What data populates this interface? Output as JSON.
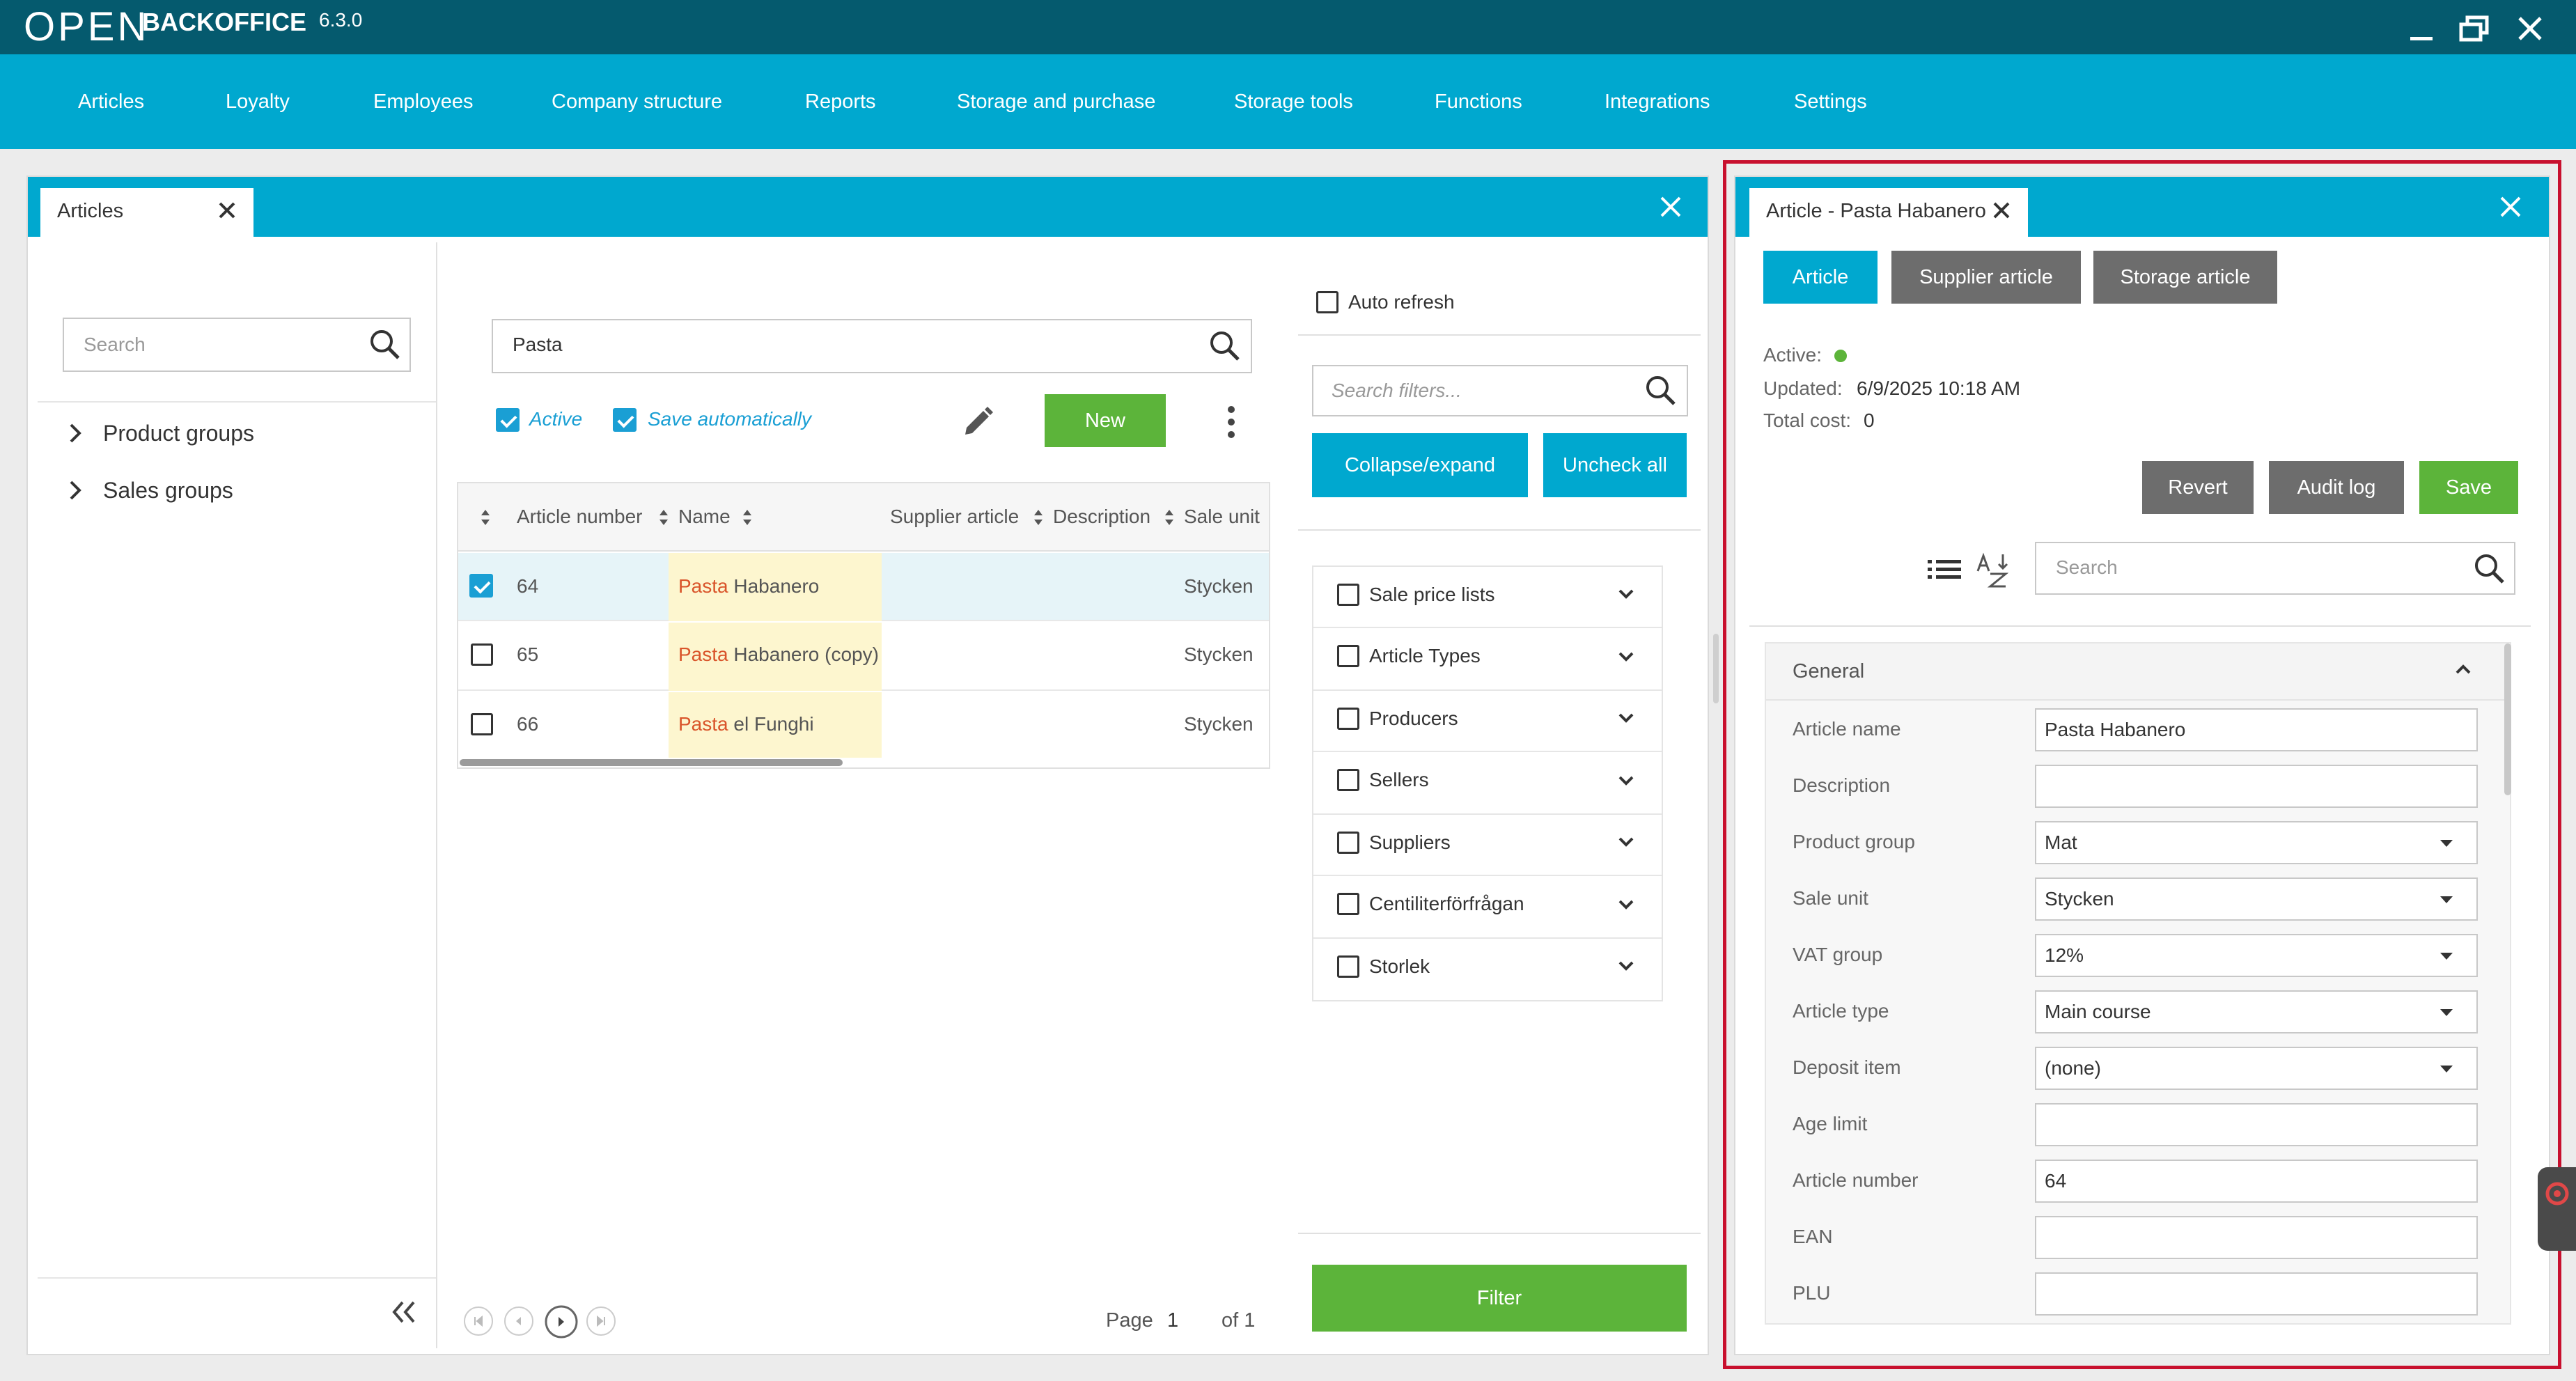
{
  "app": {
    "logo": "OPEN",
    "brand": "BACKOFFICE",
    "version": "6.3.0"
  },
  "menu": [
    "Articles",
    "Loyalty",
    "Employees",
    "Company structure",
    "Reports",
    "Storage and purchase",
    "Storage tools",
    "Functions",
    "Integrations",
    "Settings"
  ],
  "articles_panel": {
    "tab_label": "Articles",
    "tree_search_placeholder": "Search",
    "tree": [
      "Product groups",
      "Sales groups"
    ],
    "search_value": "Pasta",
    "active_label": "Active",
    "save_auto_label": "Save automatically",
    "new_label": "New",
    "columns": [
      "Article number",
      "Name",
      "Supplier article",
      "Description",
      "Sale unit"
    ],
    "rows": [
      {
        "number": "64",
        "name_highlight": "Pasta",
        "name_rest": " Habanero",
        "sale_unit": "Stycken",
        "checked": true
      },
      {
        "number": "65",
        "name_highlight": "Pasta",
        "name_rest": " Habanero (copy)",
        "sale_unit": "Stycken",
        "checked": false
      },
      {
        "number": "66",
        "name_highlight": "Pasta",
        "name_rest": " el Funghi",
        "sale_unit": "Stycken",
        "checked": false
      }
    ],
    "page_label": "Page",
    "page_number": "1",
    "of_label": "of 1"
  },
  "filters": {
    "auto_refresh_label": "Auto refresh",
    "search_placeholder": "Search filters...",
    "collapse_label": "Collapse/expand",
    "uncheck_label": "Uncheck all",
    "items": [
      "Sale price lists",
      "Article Types",
      "Producers",
      "Sellers",
      "Suppliers",
      "Centiliterförfrågan",
      "Storlek"
    ],
    "filter_button": "Filter"
  },
  "article_detail": {
    "tab_label": "Article - Pasta Habanero",
    "tabs": [
      "Article",
      "Supplier article",
      "Storage article"
    ],
    "active_label": "Active:",
    "active_color": "#5cb43a",
    "updated_label": "Updated:",
    "updated_value": "6/9/2025 10:18 AM",
    "total_cost_label": "Total cost:",
    "total_cost_value": "0",
    "revert_label": "Revert",
    "audit_label": "Audit log",
    "save_label": "Save",
    "search_placeholder": "Search",
    "section_title": "General",
    "fields": [
      {
        "label": "Article name",
        "value": "Pasta Habanero",
        "dropdown": false
      },
      {
        "label": "Description",
        "value": "",
        "dropdown": false
      },
      {
        "label": "Product group",
        "value": "Mat",
        "dropdown": true
      },
      {
        "label": "Sale unit",
        "value": "Stycken",
        "dropdown": true
      },
      {
        "label": "VAT group",
        "value": "12%",
        "dropdown": true
      },
      {
        "label": "Article type",
        "value": "Main course",
        "dropdown": true
      },
      {
        "label": "Deposit item",
        "value": "(none)",
        "dropdown": true
      },
      {
        "label": "Age limit",
        "value": "",
        "dropdown": false
      },
      {
        "label": "Article number",
        "value": "64",
        "dropdown": false
      },
      {
        "label": "EAN",
        "value": "",
        "dropdown": false
      },
      {
        "label": "PLU",
        "value": "",
        "dropdown": false
      }
    ]
  },
  "colors": {
    "titlebar": "#055a6e",
    "accent": "#00a8cf",
    "green": "#5cb43a",
    "highlight": "#d9542a",
    "outline": "#c8102e"
  }
}
